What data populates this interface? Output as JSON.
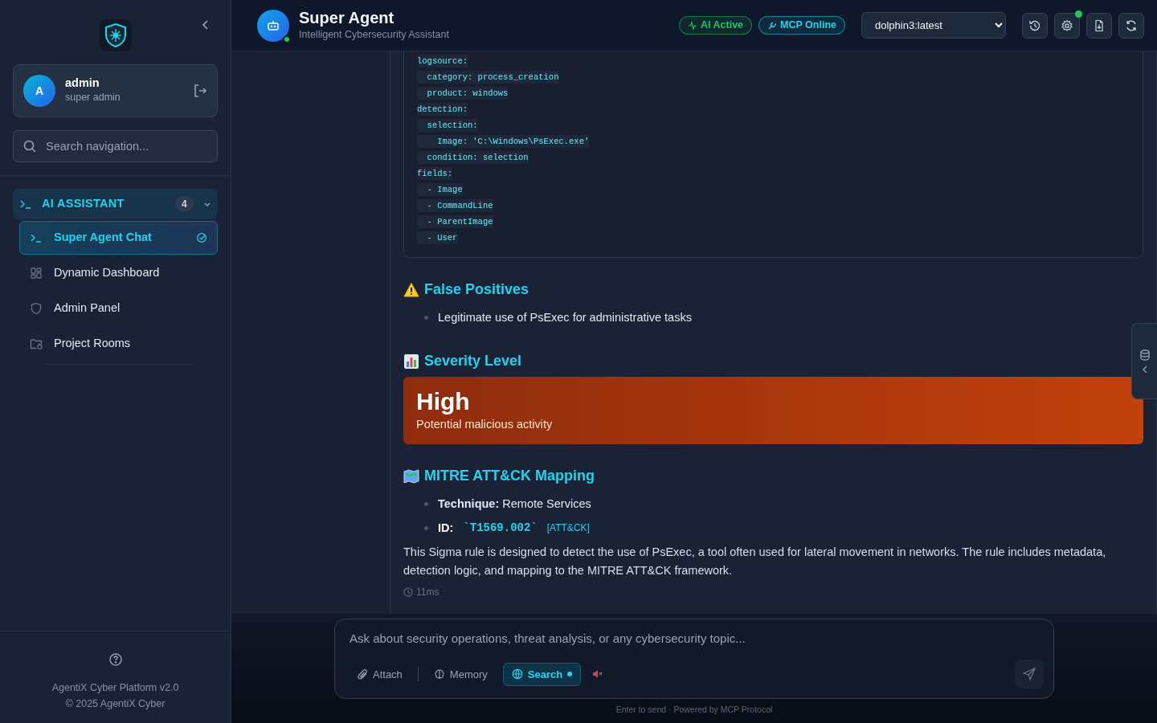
{
  "sidebar": {
    "user": {
      "initial": "A",
      "name": "admin",
      "role": "super admin"
    },
    "search": {
      "placeholder": "Search navigation..."
    },
    "nav": [
      {
        "label": "AI ASSISTANT",
        "count": "4",
        "expanded": true,
        "children": [
          {
            "label": "Super Agent Chat",
            "selected": true
          },
          {
            "label": "Dynamic Dashboard",
            "selected": false
          },
          {
            "label": "Admin Panel",
            "selected": false
          },
          {
            "label": "Project Rooms",
            "selected": false
          }
        ]
      }
    ],
    "footer": {
      "version": "AgentiX Cyber Platform v2.0",
      "copyright": "© 2025 AgentiX Cyber"
    }
  },
  "header": {
    "title": "Super Agent",
    "subtitle": "Intelligent Cybersecurity Assistant",
    "online": true,
    "badges": [
      {
        "label": "AI Active",
        "color": "#22c55e"
      },
      {
        "label": "MCP Online",
        "color": "#22d3ee"
      }
    ],
    "model": "dolphin3:latest",
    "actions": [
      {
        "kind": "history",
        "notify": false
      },
      {
        "kind": "settings",
        "notify": true
      },
      {
        "kind": "export",
        "notify": false
      },
      {
        "kind": "refresh",
        "notify": false
      }
    ]
  },
  "message": {
    "code": [
      "logsource:",
      "  category: process_creation",
      "  product: windows",
      "detection:",
      "  selection:",
      "    Image: 'C:\\Windows\\PsExec.exe'",
      "  condition: selection",
      "fields:",
      "  - Image",
      "  - CommandLine",
      "  - ParentImage",
      "  - User"
    ],
    "sections": [
      {
        "kind": "heading",
        "title": "False Positives"
      },
      {
        "kind": "bullets",
        "items": [
          {
            "text": "Legitimate use of PsExec for administrative tasks"
          }
        ]
      },
      {
        "kind": "heading",
        "title": "Severity Level"
      },
      {
        "kind": "severity",
        "rating": "High",
        "description": "Potential malicious activity"
      },
      {
        "kind": "heading",
        "title": "MITRE ATT&CK Mapping"
      },
      {
        "kind": "bullets",
        "items": [
          {
            "text": "**Technique:** Remote Services"
          },
          {
            "label": "ID:",
            "code": "`T1569.002`",
            "link": "[ATT&CK]"
          }
        ]
      },
      {
        "kind": "paragraph",
        "text": "This Sigma rule is designed to detect the use of PsExec, a tool often used for lateral movement in networks. The rule includes metadata, detection logic, and mapping to the MITRE ATT&CK framework."
      }
    ],
    "timing": "11ms"
  },
  "composer": {
    "placeholder": "Ask about security operations, threat analysis, or any cybersecurity topic...",
    "tools": [
      {
        "kind": "attach",
        "label": "Attach",
        "selected": false
      },
      {
        "kind": "memory",
        "label": "Memory",
        "selected": false
      },
      {
        "kind": "search",
        "label": "Search",
        "selected": true
      }
    ],
    "muted": true,
    "hint": "Enter to send · Powered by MCP Protocol"
  }
}
